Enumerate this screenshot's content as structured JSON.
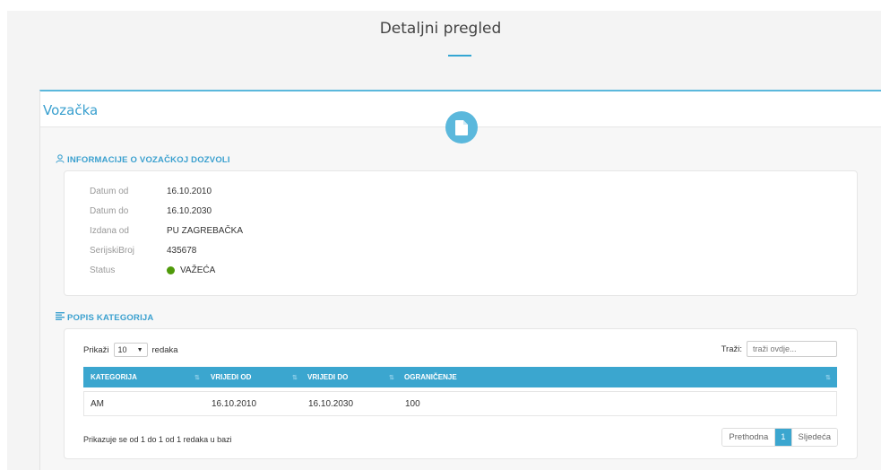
{
  "page": {
    "title": "Detaljni pregled"
  },
  "card": {
    "title": "Vozačka",
    "badge_icon": "document-icon"
  },
  "licence_info": {
    "heading": "INFORMACIJE O VOZAČKOJ DOZVOLI",
    "heading_icon": "user-icon",
    "rows": [
      {
        "label": "Datum od",
        "value": "16.10.2010"
      },
      {
        "label": "Datum do",
        "value": "16.10.2030"
      },
      {
        "label": "Izdana od",
        "value": "PU ZAGREBAČKA"
      },
      {
        "label": "SerijskiBroj",
        "value": "435678"
      },
      {
        "label": "Status",
        "value": "VAŽEĆA",
        "status_color": "#4f9a0a"
      }
    ]
  },
  "categories": {
    "heading": "POPIS KATEGORIJA",
    "heading_icon": "list-icon",
    "length": {
      "prefix": "Prikaži",
      "value": "10",
      "suffix": "redaka"
    },
    "search": {
      "label": "Traži:",
      "placeholder": "traži ovdje..."
    },
    "columns": [
      "KATEGORIJA",
      "VRIJEDI OD",
      "VRIJEDI DO",
      "OGRANIČENJE"
    ],
    "rows": [
      [
        "AM",
        "16.10.2010",
        "16.10.2030",
        "100"
      ]
    ],
    "info": "Prikazuje se od 1 do 1 od 1 redaka u bazi",
    "pagination": {
      "prev": "Prethodna",
      "current": "1",
      "next": "Sljedeća"
    }
  },
  "colors": {
    "accent": "#3ba6cf",
    "status_valid": "#4f9a0a"
  }
}
